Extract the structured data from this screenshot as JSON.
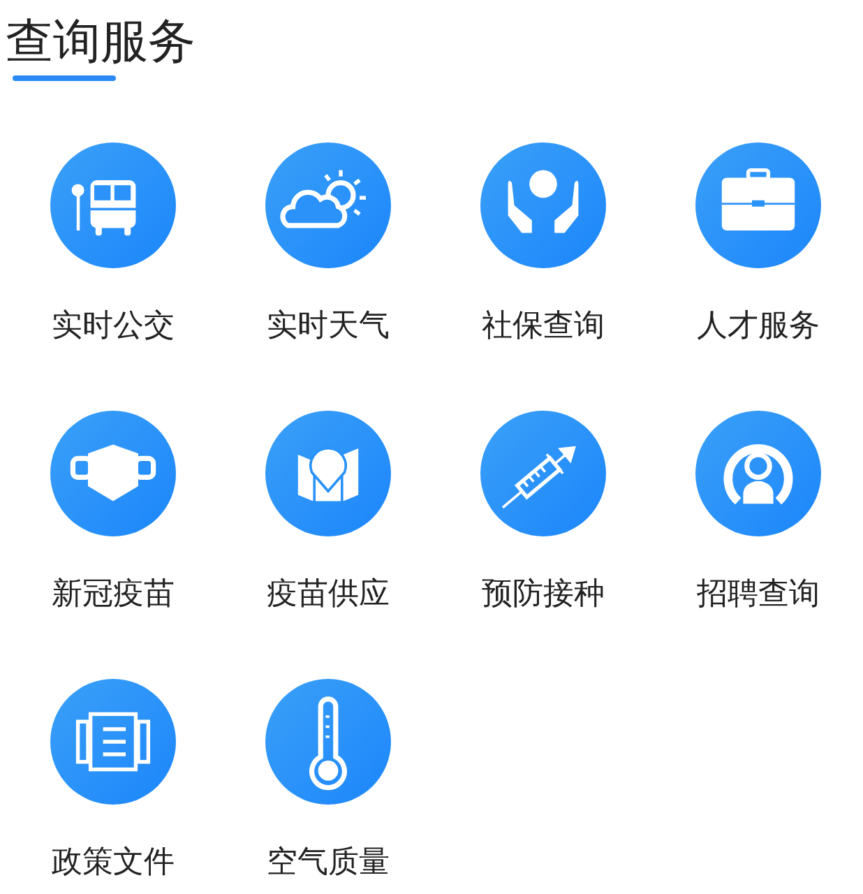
{
  "title": "查询服务",
  "services": [
    {
      "label": "实时公交",
      "kind": "bus"
    },
    {
      "label": "实时天气",
      "kind": "weather"
    },
    {
      "label": "社保查询",
      "kind": "care"
    },
    {
      "label": "人才服务",
      "kind": "briefcase"
    },
    {
      "label": "新冠疫苗",
      "kind": "mask"
    },
    {
      "label": "疫苗供应",
      "kind": "map"
    },
    {
      "label": "预防接种",
      "kind": "syringe"
    },
    {
      "label": "招聘查询",
      "kind": "person"
    },
    {
      "label": "政策文件",
      "kind": "document"
    },
    {
      "label": "空气质量",
      "kind": "thermometer"
    }
  ]
}
